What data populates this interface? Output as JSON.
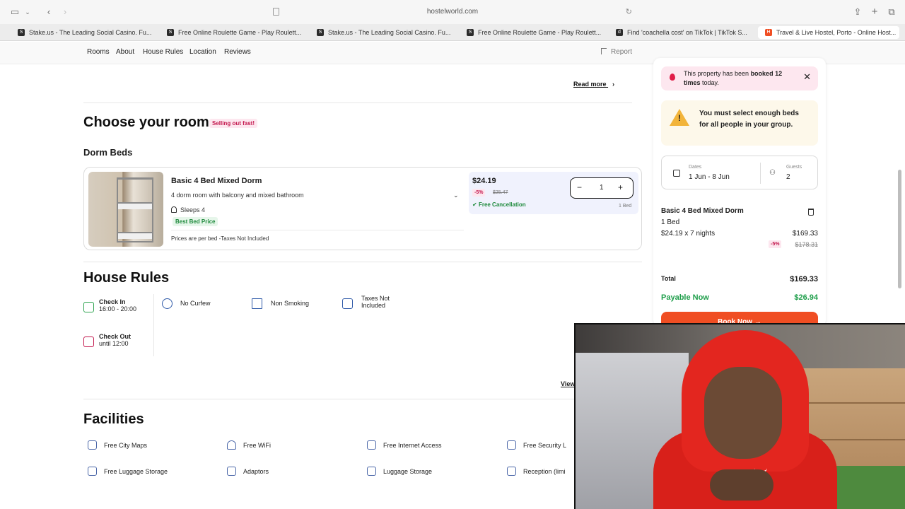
{
  "browser": {
    "url": "hostelworld.com",
    "tabs": [
      {
        "favicon": "S",
        "title": "Stake.us - The Leading Social Casino. Fu..."
      },
      {
        "favicon": "S",
        "title": "Free Online Roulette Game - Play Roulett..."
      },
      {
        "favicon": "S",
        "title": "Stake.us - The Leading Social Casino. Fu..."
      },
      {
        "favicon": "S",
        "title": "Free Online Roulette Game - Play Roulett..."
      },
      {
        "favicon": "d",
        "title": "Find 'coachella cost' on TikTok | TikTok S..."
      },
      {
        "favicon": "H",
        "title": "Travel & Live Hostel, Porto - Online Host..."
      }
    ]
  },
  "subnav": {
    "links": [
      "Rooms",
      "About",
      "House Rules",
      "Location",
      "Reviews"
    ],
    "report": "Report"
  },
  "read_more": "Read more",
  "choose_room": {
    "title": "Choose your room",
    "badge": "Selling out fast!",
    "section": "Dorm Beds"
  },
  "room": {
    "name": "Basic 4 Bed Mixed Dorm",
    "description": "4 dorm room with balcony and mixed bathroom",
    "sleeps": "Sleeps 4",
    "badge": "Best Bed Price",
    "note": "Prices are per bed -Taxes Not Included",
    "price": "$24.19",
    "discount": "-5%",
    "old_price": "$25.47",
    "cancellation": "Free Cancellation",
    "quantity": "1",
    "bed_count": "1 Bed"
  },
  "house_rules": {
    "title": "House Rules",
    "check_in_label": "Check In",
    "check_in_value": "16:00 - 20:00",
    "check_out_label": "Check Out",
    "check_out_value": "until 12:00",
    "no_curfew": "No Curfew",
    "non_smoking": "Non Smoking",
    "taxes_line1": "Taxes Not",
    "taxes_line2": "Included",
    "view_link": "View"
  },
  "facilities": {
    "title": "Facilities",
    "items": [
      "Free City Maps",
      "Free WiFi",
      "Free Internet Access",
      "Free Security L",
      "Free Luggage Storage",
      "Adaptors",
      "Luggage Storage",
      "Reception (limi"
    ]
  },
  "sidebar": {
    "booked_pre": "This property has been ",
    "booked_bold1": "booked 12",
    "booked_bold2": "times",
    "booked_post": " today.",
    "warning": "You must select enough beds for all people in your group.",
    "dates_label": "Dates",
    "dates_value": "1 Jun - 8 Jun",
    "guests_label": "Guests",
    "guests_value": "2",
    "summary_name": "Basic 4 Bed Mixed Dorm",
    "summary_beds": "1 Bed",
    "summary_line": "$24.19 x 7 nights",
    "summary_amount": "$169.33",
    "summary_discount": "-5%",
    "summary_old": "$178.31",
    "total_label": "Total",
    "total_value": "$169.33",
    "payable_label": "Payable Now",
    "payable_value": "$26.94",
    "book_button": "Book Now →"
  },
  "colors": {
    "brand_orange": "#f04e23",
    "green": "#1e9e4a",
    "pink_badge": "#c3174d",
    "price_box": "#f0f2fd"
  }
}
